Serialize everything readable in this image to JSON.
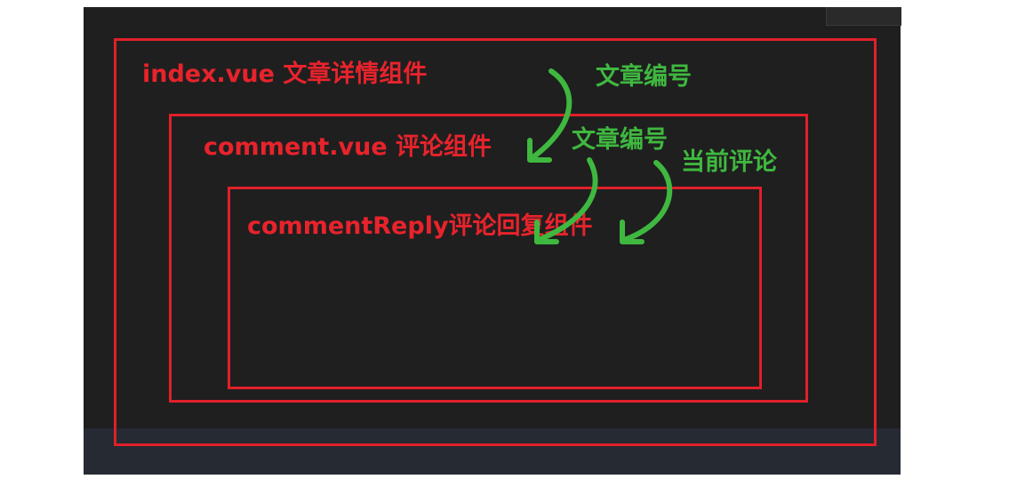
{
  "boxes": {
    "outer": {
      "label": "index.vue 文章详情组件"
    },
    "middle": {
      "label": "comment.vue 评论组件"
    },
    "inner": {
      "label": "commentReply评论回复组件"
    }
  },
  "annotations": {
    "article_id_1": "文章编号",
    "article_id_2": "文章编号",
    "current_comment": "当前评论"
  },
  "colors": {
    "box_border": "#e0202a",
    "label_red": "#e8232c",
    "label_green": "#3fb83f",
    "background": "#1f1f1f"
  },
  "icons": [
    "arrow-down-curved-icon"
  ]
}
